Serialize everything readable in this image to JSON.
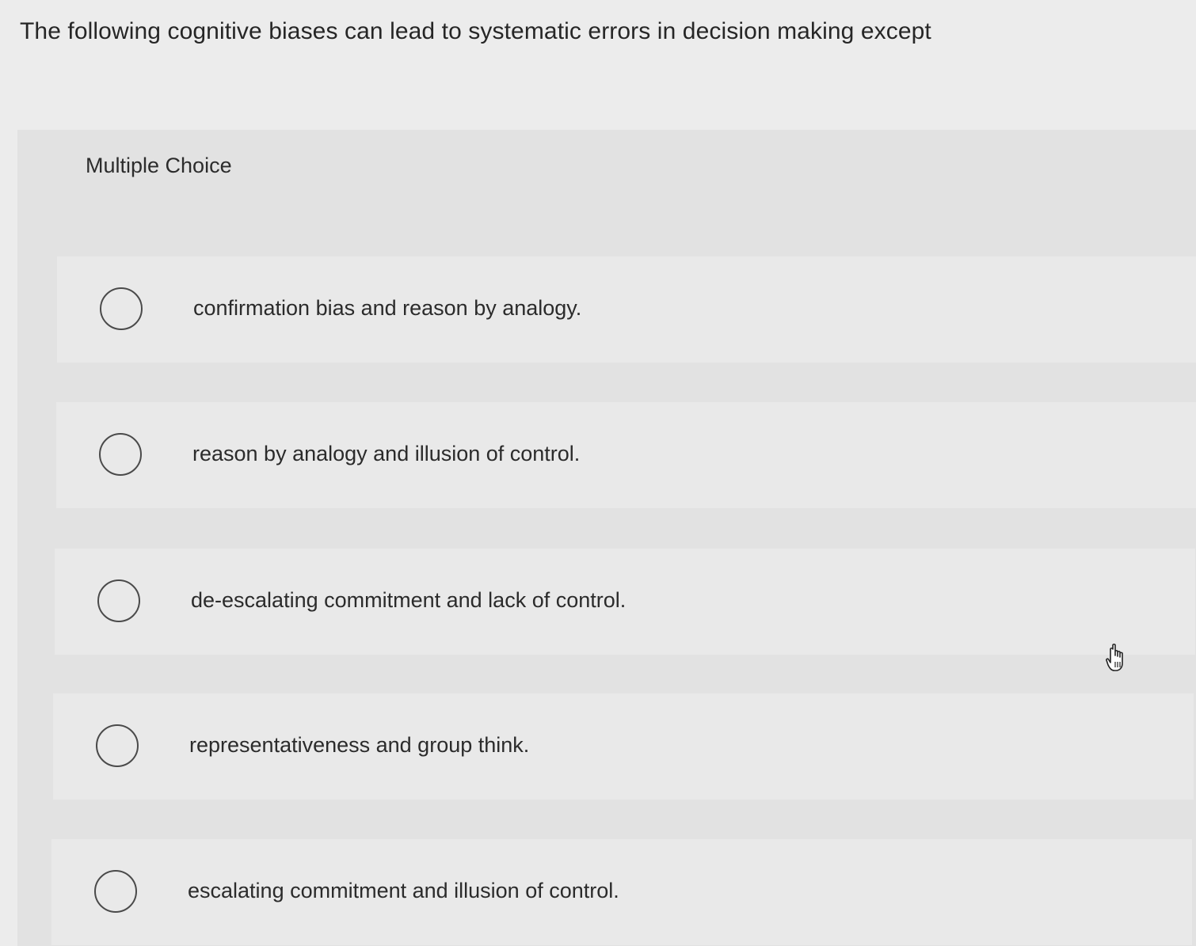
{
  "question": {
    "text": "The following cognitive biases can lead to systematic errors in decision making except"
  },
  "panel": {
    "type_label": "Multiple Choice"
  },
  "choices": [
    {
      "label": "confirmation bias and reason by analogy.",
      "selected": false
    },
    {
      "label": "reason by analogy and illusion of control.",
      "selected": false
    },
    {
      "label": "de-escalating commitment and lack of control.",
      "selected": false
    },
    {
      "label": "representativeness and group think.",
      "selected": false
    },
    {
      "label": "escalating commitment and illusion of control.",
      "selected": false
    }
  ],
  "colors": {
    "page_background": "#ececec",
    "panel_background": "#e2e2e2",
    "choice_background": "#e9e9e9",
    "radio_border": "#4a4a4a",
    "text": "#2b2b2b"
  },
  "icons": {
    "cursor": "hand-pointer-icon"
  }
}
